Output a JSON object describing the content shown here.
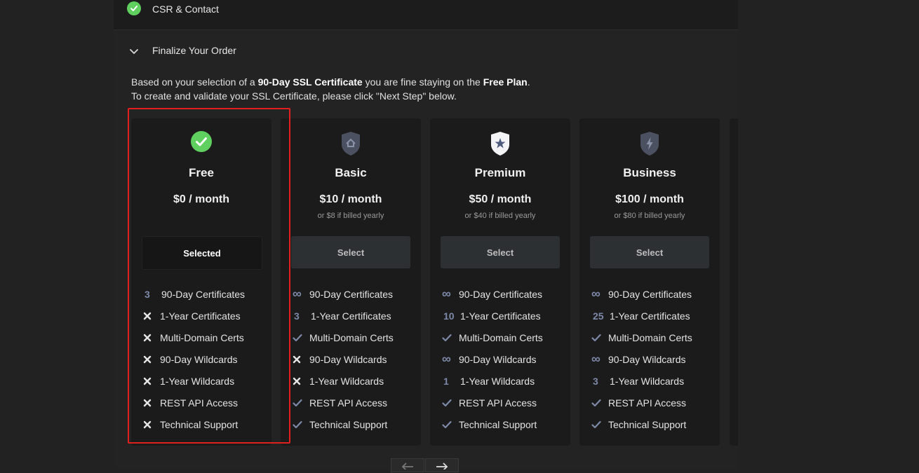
{
  "steps": {
    "completed_title": "CSR & Contact",
    "current_title": "Finalize Your Order"
  },
  "intro": {
    "line1_prefix": "Based on your selection of a ",
    "line1_cert": "90-Day SSL Certificate",
    "line1_middle": " you are fine staying on the ",
    "line1_plan": "Free Plan",
    "line1_suffix": ".",
    "line2": "To create and validate your SSL Certificate, please click \"Next Step\" below."
  },
  "plans": [
    {
      "name": "Free",
      "price": "$0 / month",
      "yearly": "",
      "button": "Selected",
      "icon": "check-circle-icon",
      "features": [
        {
          "mark": "3",
          "label": "90-Day Certificates"
        },
        {
          "mark": "x",
          "label": "1-Year Certificates"
        },
        {
          "mark": "x",
          "label": "Multi-Domain Certs"
        },
        {
          "mark": "x",
          "label": "90-Day Wildcards"
        },
        {
          "mark": "x",
          "label": "1-Year Wildcards"
        },
        {
          "mark": "x",
          "label": "REST API Access"
        },
        {
          "mark": "x",
          "label": "Technical Support"
        }
      ]
    },
    {
      "name": "Basic",
      "price": "$10 / month",
      "yearly": "or $8 if billed yearly",
      "button": "Select",
      "icon": "shield-home-icon",
      "features": [
        {
          "mark": "∞",
          "label": "90-Day Certificates"
        },
        {
          "mark": "3",
          "label": "1-Year Certificates"
        },
        {
          "mark": "✓",
          "label": "Multi-Domain Certs"
        },
        {
          "mark": "x",
          "label": "90-Day Wildcards"
        },
        {
          "mark": "x",
          "label": "1-Year Wildcards"
        },
        {
          "mark": "✓",
          "label": "REST API Access"
        },
        {
          "mark": "✓",
          "label": "Technical Support"
        }
      ]
    },
    {
      "name": "Premium",
      "price": "$50 / month",
      "yearly": "or $40 if billed yearly",
      "button": "Select",
      "icon": "shield-star-icon",
      "features": [
        {
          "mark": "∞",
          "label": "90-Day Certificates"
        },
        {
          "mark": "10",
          "label": "1-Year Certificates"
        },
        {
          "mark": "✓",
          "label": "Multi-Domain Certs"
        },
        {
          "mark": "∞",
          "label": "90-Day Wildcards"
        },
        {
          "mark": "1",
          "label": "1-Year Wildcards"
        },
        {
          "mark": "✓",
          "label": "REST API Access"
        },
        {
          "mark": "✓",
          "label": "Technical Support"
        }
      ]
    },
    {
      "name": "Business",
      "price": "$100 / month",
      "yearly": "or $80 if billed yearly",
      "button": "Select",
      "icon": "shield-bolt-icon",
      "features": [
        {
          "mark": "∞",
          "label": "90-Day Certificates"
        },
        {
          "mark": "25",
          "label": "1-Year Certificates"
        },
        {
          "mark": "✓",
          "label": "Multi-Domain Certs"
        },
        {
          "mark": "∞",
          "label": "90-Day Wildcards"
        },
        {
          "mark": "3",
          "label": "1-Year Wildcards"
        },
        {
          "mark": "✓",
          "label": "REST API Access"
        },
        {
          "mark": "✓",
          "label": "Technical Support"
        }
      ]
    }
  ],
  "icons": {
    "prev": "arrow-left-icon",
    "next": "arrow-right-icon"
  },
  "colors": {
    "success": "#5fcf5f",
    "mark": "#7d89a8",
    "highlight": "#e01f1f"
  }
}
